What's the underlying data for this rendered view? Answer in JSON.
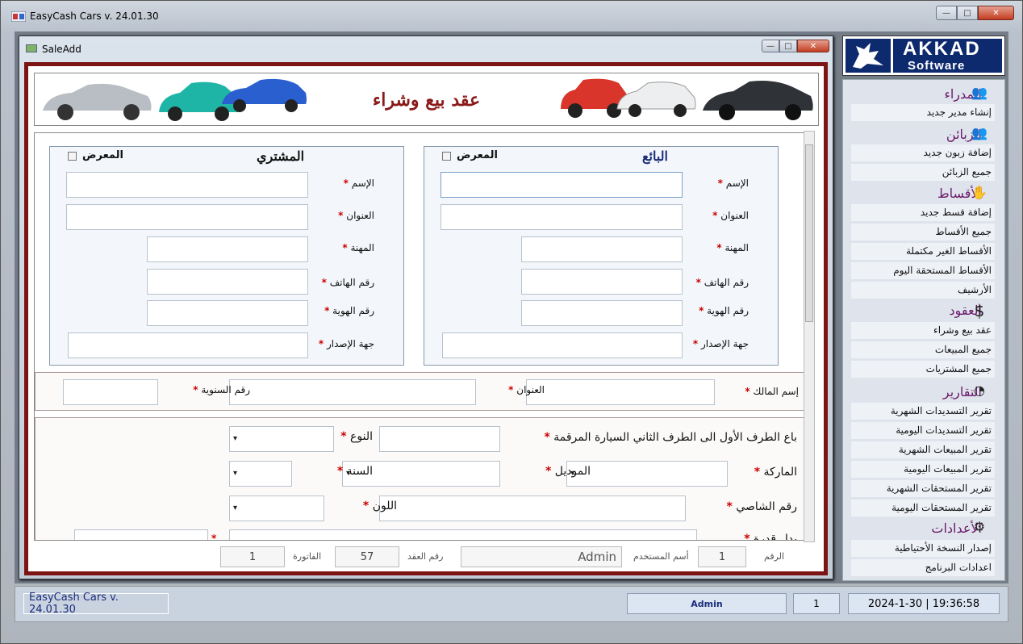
{
  "app": {
    "title": "EasyCash Cars  v. 24.01.30"
  },
  "child": {
    "title": "SaleAdd"
  },
  "banner": {
    "title": "عقد بيع وشراء"
  },
  "seller": {
    "heading": "البائع",
    "showroom": "المعرض",
    "fields": [
      "الإسم",
      "العنوان",
      "المهنة",
      "رقم الهاتف",
      "رقم الهوية",
      "جهة الإصدار"
    ]
  },
  "buyer": {
    "heading": "المشتري",
    "showroom": "المعرض",
    "fields": [
      "الإسم",
      "العنوان",
      "المهنة",
      "رقم الهاتف",
      "رقم الهوية",
      "جهة الإصدار"
    ]
  },
  "owner": {
    "name_label": "إسم المالك",
    "address_label": "العنوان",
    "annual_label": "رقم السنوية"
  },
  "vehicle": {
    "sold_label": "باع الطرف الأول الى الطرف الثاني السيارة المرقمة",
    "type_label": "النوع",
    "brand_label": "الماركة",
    "model_label": "الموديل",
    "year_label": "السنة",
    "chassis_label": "رقم الشاصي",
    "color_label": "اللون",
    "price_label": "بدل قدرة"
  },
  "footer": {
    "number_label": "الرقم",
    "number": "1",
    "user_label": "أسم المستخدم",
    "user": "Admin",
    "contract_label": "رقم العقد",
    "contract": "57",
    "invoice_label": "الفاتورة",
    "invoice": "1"
  },
  "logo": {
    "line1": "AKKAD",
    "line2": "Software"
  },
  "sidebar": {
    "managers": {
      "title": "المدراء",
      "items": [
        "إنشاء مدير جديد"
      ]
    },
    "customers": {
      "title": "الزبائن",
      "items": [
        "إضافة زبون جديد",
        "جميع الزبائن"
      ]
    },
    "installments": {
      "title": "الأقساط",
      "items": [
        "إضافة قسط جديد",
        "جميع الأقساط",
        "الأقساط الغير مكتملة",
        "الأقساط المستحقة اليوم",
        "الأرشيف"
      ]
    },
    "contracts": {
      "title": "العقود",
      "items": [
        "عقد بيع وشراء",
        "جميع المبيعات",
        "جميع المشتريات"
      ]
    },
    "reports": {
      "title": "التقارير",
      "items": [
        "تقرير التسديدات الشهرية",
        "تقرير التسديدات اليومية",
        "تقرير المبيعات الشهرية",
        "تقرير المبيعات اليومية",
        "تقرير المستحقات الشهرية",
        "تقرير المستحقات اليومية"
      ]
    },
    "settings": {
      "title": "الأعدادات",
      "items": [
        "إصدار النسخة الأحتياطية",
        "اعدادات البرنامج"
      ]
    }
  },
  "status": {
    "app": "EasyCash Cars  v. 24.01.30",
    "user": "Admin",
    "count": "1",
    "datetime": "2024-1-30 | 19:36:58"
  },
  "icons": {
    "app": "app-icon",
    "managers": "users-icon",
    "customers": "users-icon",
    "installments": "hand-coin-icon",
    "contracts": "dollar-icon",
    "reports": "pie-chart-icon",
    "settings": "gear-icon"
  },
  "colors": {
    "accent": "#7d1414",
    "heading": "#6b1a6b"
  }
}
